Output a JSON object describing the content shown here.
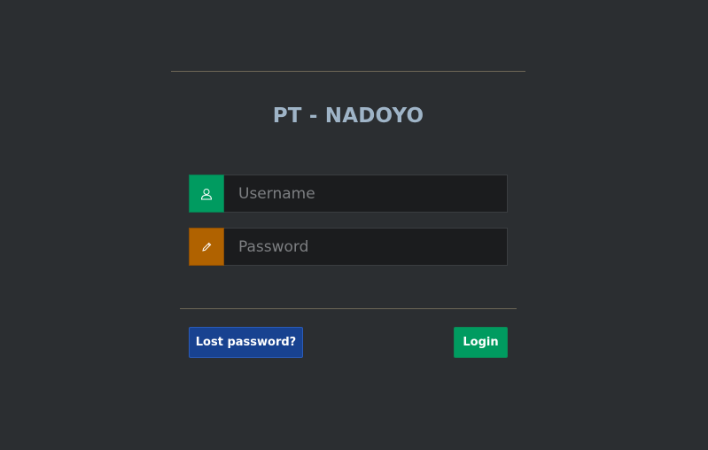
{
  "title": "PT - NADOYO",
  "username": {
    "placeholder": "Username",
    "value": "",
    "icon": "user-icon",
    "accent_color": "#009b60"
  },
  "password": {
    "placeholder": "Password",
    "value": "",
    "icon": "pencil-icon",
    "accent_color": "#b06200"
  },
  "buttons": {
    "lost_password_label": "Lost password?",
    "login_label": "Login"
  },
  "colors": {
    "background": "#2b2e31",
    "title": "#9fb4c7",
    "primary_button": "#184290",
    "success_button": "#009b60"
  }
}
